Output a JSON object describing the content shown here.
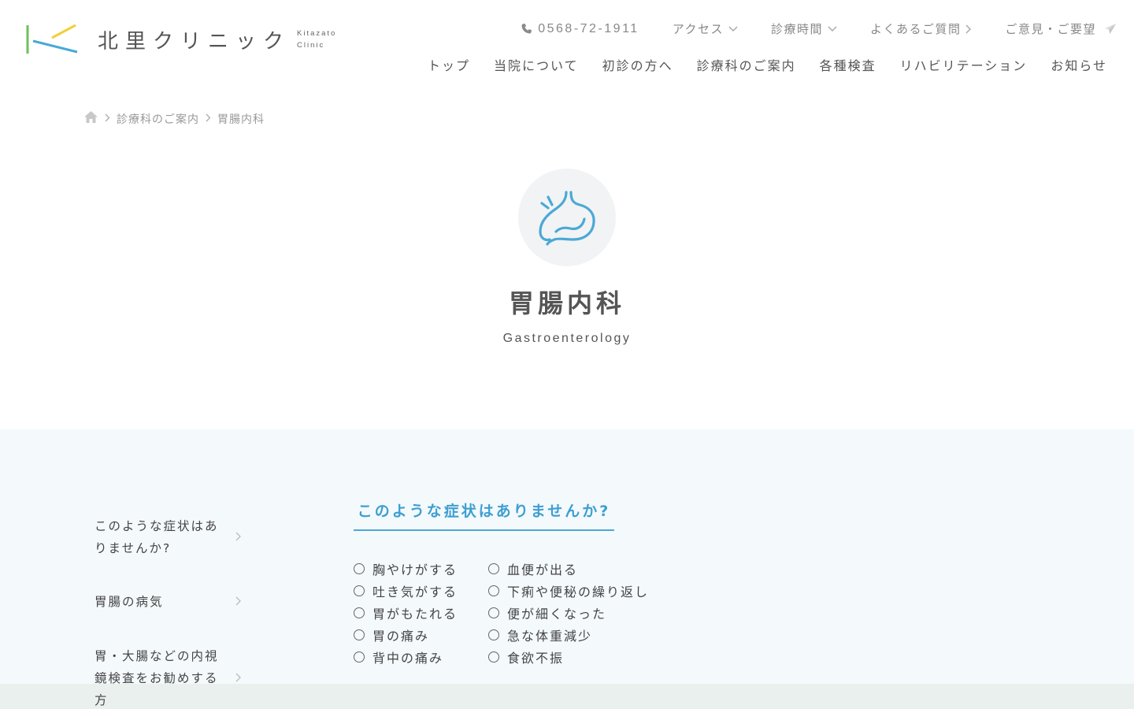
{
  "header": {
    "logo_title": "北里クリニック",
    "logo_sub_line1": "Kitazato",
    "logo_sub_line2": "Clinic",
    "phone": "0568-72-1911",
    "top_links": [
      "アクセス",
      "診療時間",
      "よくあるご質問",
      "ご意見・ご要望"
    ],
    "main_nav": [
      "トップ",
      "当院について",
      "初診の方へ",
      "診療科のご案内",
      "各種検査",
      "リハビリテーション",
      "お知らせ"
    ]
  },
  "breadcrumb": {
    "items": [
      "診療科のご案内",
      "胃腸内科"
    ]
  },
  "hero": {
    "title": "胃腸内科",
    "subtitle": "Gastroenterology"
  },
  "side_menu": [
    "このような症状はありませんか?",
    "胃腸の病気",
    "胃・大腸などの内視鏡検査をお勧めする方"
  ],
  "section": {
    "title": "このような症状はありませんか?",
    "symptoms_col1": [
      "胸やけがする",
      "吐き気がする",
      "胃がもたれる",
      "胃の痛み",
      "背中の痛み"
    ],
    "symptoms_col2": [
      "血便が出る",
      "下痢や便秘の繰り返し",
      "便が細くなった",
      "急な体重減少",
      "食欲不振"
    ]
  },
  "colors": {
    "accent_blue": "#4aa9d6",
    "logo_green": "#6cc25a",
    "logo_yellow": "#f3cf3a",
    "band_bg": "#f4f9fc"
  }
}
